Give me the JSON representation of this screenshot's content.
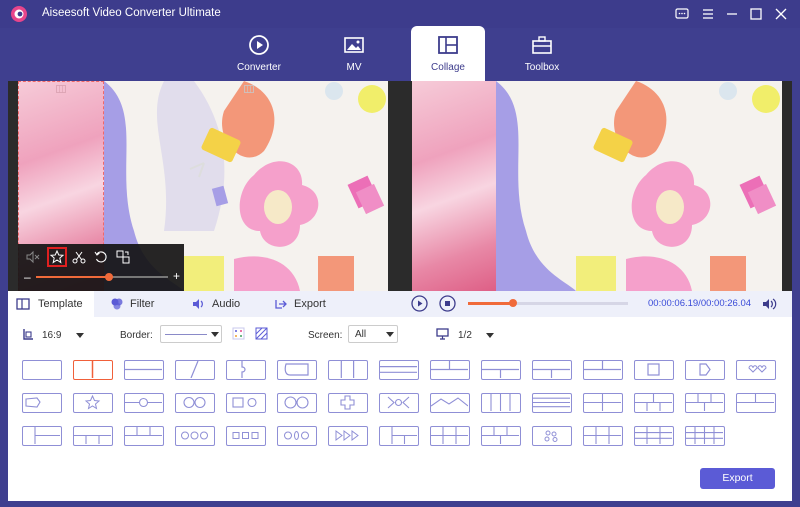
{
  "app": {
    "title": "Aiseesoft Video Converter Ultimate"
  },
  "nav": [
    {
      "label": "Converter",
      "icon": "converter-icon"
    },
    {
      "label": "MV",
      "icon": "mv-icon"
    },
    {
      "label": "Collage",
      "icon": "collage-icon",
      "active": true
    },
    {
      "label": "Toolbox",
      "icon": "toolbox-icon"
    }
  ],
  "tabs": [
    {
      "label": "Template",
      "icon": "template-icon",
      "active": true
    },
    {
      "label": "Filter",
      "icon": "filter-icon"
    },
    {
      "label": "Audio",
      "icon": "audio-icon"
    },
    {
      "label": "Export",
      "icon": "export-icon"
    }
  ],
  "playback": {
    "time": "00:00:06.19/00:00:26.04",
    "progress": 0.28
  },
  "clip_toolbar": {
    "volume": 0.55
  },
  "options": {
    "aspect": "16:9",
    "border_label": "Border:",
    "screen_label": "Screen:",
    "screen_value": "All",
    "page": "1/2"
  },
  "export_label": "Export",
  "colors": {
    "accent": "#5b5bd6",
    "header": "#3d3c8c",
    "progress": "#f06a3a",
    "template_border": "#8f8fd6"
  }
}
